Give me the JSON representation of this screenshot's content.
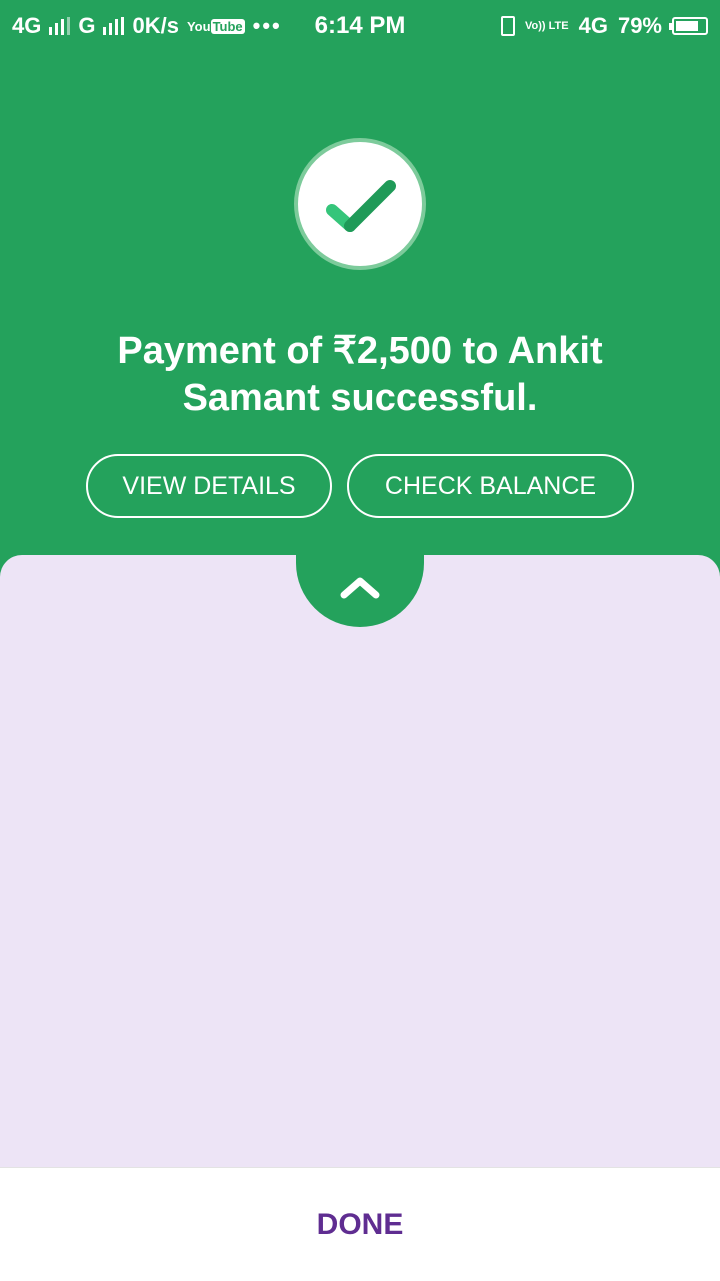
{
  "colors": {
    "green": "#24a25c",
    "sheet": "#ede4f6",
    "purple": "#5f2d91",
    "check_dark": "#1f9a58",
    "check_light": "#35c57a"
  },
  "status_bar": {
    "network1": "4G",
    "network2": "G",
    "speed": "0K/s",
    "youtube": "You",
    "youtube_tube": "Tube",
    "dots": "•••",
    "time": "6:14 PM",
    "volte": "Vo)) LTE",
    "network3": "4G",
    "battery": "79%",
    "battery_level": 79
  },
  "success": {
    "icon": "checkmark-icon",
    "message": "Payment of ₹2,500 to Ankit Samant successful."
  },
  "actions": {
    "view_details": "VIEW DETAILS",
    "check_balance": "CHECK BALANCE"
  },
  "sheet": {
    "icon": "chevron-up-icon"
  },
  "footer": {
    "done": "DONE"
  }
}
